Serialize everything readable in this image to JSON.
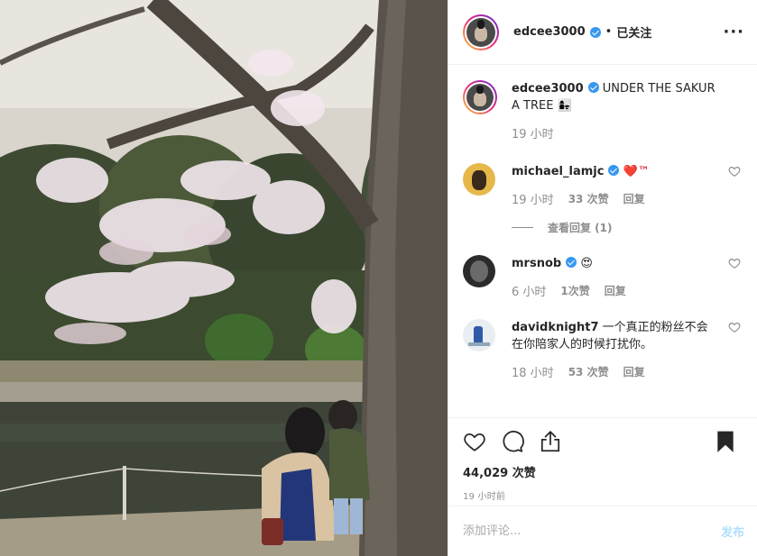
{
  "post": {
    "username": "edcee3000",
    "follow_state": "已关注",
    "separator": "•",
    "more_icon": "more-options-icon",
    "caption_text": "UNDER THE SAKURA TREE 👩‍👧",
    "caption_time": "19 小时"
  },
  "comments": [
    {
      "username": "michael_lamjc",
      "verified": true,
      "text": "❤️™",
      "time": "19 小时",
      "likes": "33 次赞",
      "reply": "回复",
      "view_replies": "查看回复 (1)"
    },
    {
      "username": "mrsnob",
      "verified": true,
      "text": "😍",
      "time": "6 小时",
      "likes": "1次赞",
      "reply": "回复"
    },
    {
      "username": "davidknight7",
      "verified": false,
      "text": "一个真正的粉丝不会在你陪家人的时候打扰你。",
      "time": "18 小时",
      "likes": "53 次赞",
      "reply": "回复"
    }
  ],
  "actions": {
    "like_icon": "heart-icon",
    "comment_icon": "comment-icon",
    "share_icon": "share-icon",
    "save_icon": "bookmark-icon",
    "likes_count": "44,029 次赞",
    "post_time": "19 小时前"
  },
  "add_comment": {
    "placeholder": "添加评论...",
    "post_label": "发布"
  },
  "colors": {
    "verified": "#3897f0",
    "post_button": "#b2dffc",
    "muted": "#8e8e8e"
  }
}
